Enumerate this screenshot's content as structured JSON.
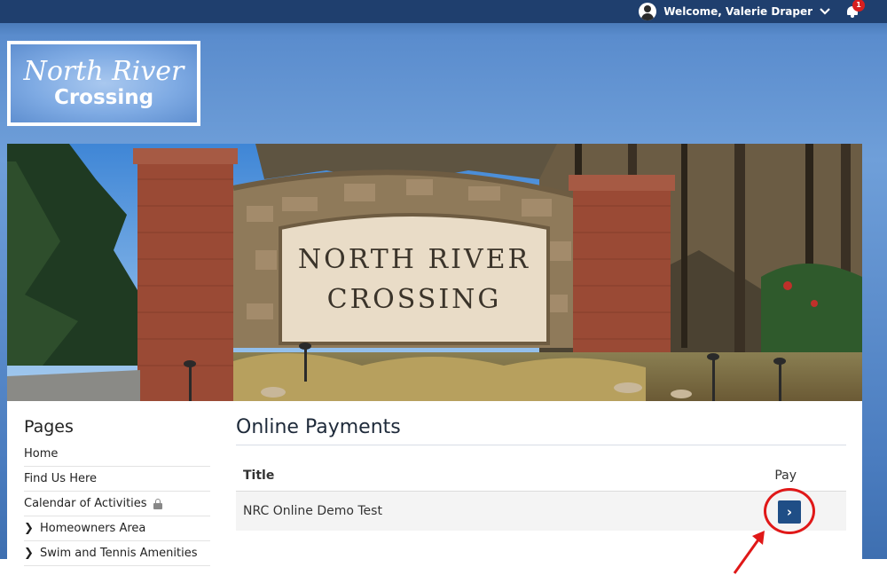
{
  "topbar": {
    "welcome": "Welcome, Valerie Draper",
    "notification_count": "1",
    "user_icon": "user-circle-icon",
    "dropdown_icon": "chevron-down-icon",
    "bell_icon": "bell-icon"
  },
  "logo": {
    "line1": "North River",
    "line2": "Crossing"
  },
  "hero": {
    "sign_line1": "NORTH RIVER",
    "sign_line2": "CROSSING"
  },
  "sidebar": {
    "title": "Pages",
    "items": [
      {
        "label": "Home"
      },
      {
        "label": "Find Us Here"
      },
      {
        "label": "Calendar of Activities",
        "icon": "lock-icon"
      },
      {
        "label": "Homeowners Area",
        "icon": "chevron-right-icon"
      },
      {
        "label": "Swim and Tennis Amenities",
        "icon": "chevron-right-icon"
      }
    ]
  },
  "main": {
    "title": "Online Payments",
    "table": {
      "columns": [
        "Title",
        "Pay"
      ],
      "rows": [
        {
          "title": "NRC Online Demo Test"
        }
      ]
    },
    "pay_button_glyph": "›"
  },
  "colors": {
    "topbar": "#1f3f6e",
    "accent_blue": "#1f4e86",
    "annotation_red": "#e01818"
  }
}
